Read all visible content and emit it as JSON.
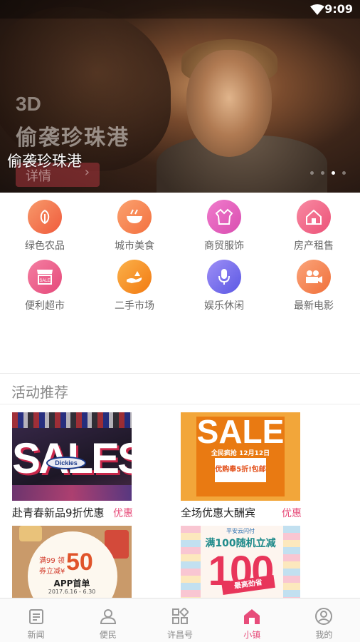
{
  "status_bar": {
    "time": "9:09"
  },
  "banner": {
    "poster_3d": "3D",
    "poster_title": "偷袭珍珠港",
    "poster_button": "详情",
    "caption": "偷袭珍珠港",
    "dot_count": 4,
    "active_dot": 3
  },
  "categories": [
    {
      "label": "绿色农品",
      "icon": "leaf-icon",
      "color": "#f36a44"
    },
    {
      "label": "城市美食",
      "icon": "food-bowl-icon",
      "color": "#f58a57"
    },
    {
      "label": "商贸服饰",
      "icon": "jacket-icon",
      "color": "#e65fbe"
    },
    {
      "label": "房产租售",
      "icon": "house-icon",
      "color": "#f06486"
    },
    {
      "label": "便利超市",
      "icon": "store-icon",
      "color": "#ec5f8e"
    },
    {
      "label": "二手市场",
      "icon": "hand-icon",
      "color": "#f79223"
    },
    {
      "label": "娱乐休闲",
      "icon": "microphone-icon",
      "color": "#7b6cf0"
    },
    {
      "label": "最新电影",
      "icon": "movie-camera-icon",
      "color": "#f48a4f"
    }
  ],
  "section": {
    "title": "活动推荐"
  },
  "cards": [
    {
      "title": "赴青春新品9折优惠",
      "tag": "优惠",
      "img_text": "SALES",
      "img_sub": "Dickies"
    },
    {
      "title": "全场优惠大酬宾",
      "tag": "优惠",
      "img_text": "SALE",
      "img_sub": "全民疯抢 12月12日",
      "img_sub2": "优购奉5折!包邮"
    },
    {
      "title": "",
      "tag": "",
      "img_text": "50",
      "img_sub": "满99 领券立减¥",
      "img_sub2": "APP首单",
      "img_sub3": "2017.6.16 - 6.30"
    },
    {
      "title": "",
      "tag": "",
      "img_text": "100",
      "img_sub": "平安云闪付",
      "img_sub2": "满100随机立减",
      "img_sub3": "最高劲省"
    }
  ],
  "tabs": [
    {
      "label": "新闻",
      "icon": "news-icon",
      "active": false
    },
    {
      "label": "便民",
      "icon": "people-icon",
      "active": false
    },
    {
      "label": "许昌号",
      "icon": "grid-icon",
      "active": false
    },
    {
      "label": "小镇",
      "icon": "home-icon",
      "active": true
    },
    {
      "label": "我的",
      "icon": "profile-icon",
      "active": false
    }
  ],
  "colors": {
    "accent": "#e74c7a",
    "label_gray": "#666666"
  }
}
